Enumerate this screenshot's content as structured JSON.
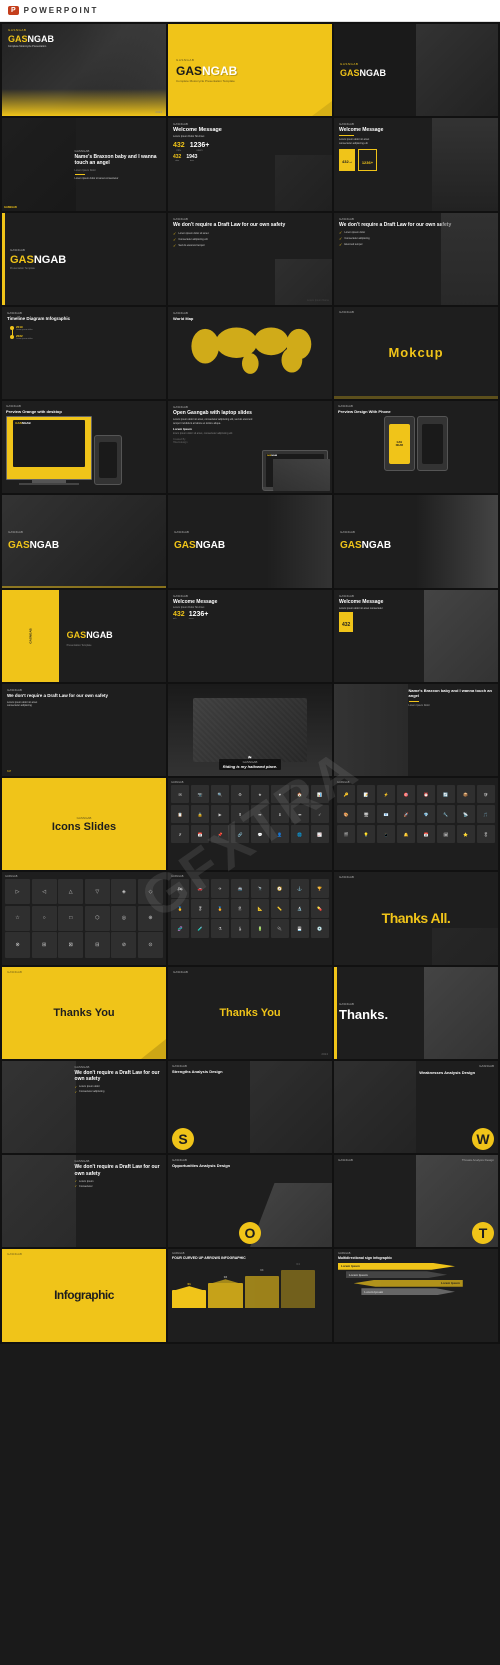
{
  "app": {
    "name": "POWERPOINT",
    "icon": "P",
    "watermark": "GFXTRA"
  },
  "slides": {
    "rows": [
      {
        "id": "row0",
        "slides": [
          {
            "id": "s0-0",
            "type": "top-bar",
            "label": "POWERPOINT",
            "content": "preview_header"
          }
        ]
      },
      {
        "id": "row1",
        "slides": [
          {
            "id": "s1-1",
            "type": "hero-dark",
            "title_yellow": "GAS",
            "title_white": "NGAB",
            "subtitle": ""
          },
          {
            "id": "s1-2",
            "type": "hero-yellow",
            "title_dark": "GAS",
            "title_dark2": "NGAB",
            "subtitle": "Complete Motorcycle Presentation Template"
          },
          {
            "id": "s1-3",
            "type": "hero-dark-bike",
            "title_yellow": "GAS",
            "title_white": "NGAB"
          }
        ]
      },
      {
        "id": "row2",
        "slides": [
          {
            "id": "s2-1",
            "type": "welcome-dark",
            "label": "GASNGAB",
            "name": "Name's Braxxon baby and I wanna touch an angel"
          },
          {
            "id": "s2-2",
            "type": "welcome-message",
            "label": "GASNGAB",
            "heading": "Welcome Message",
            "stats": [
              {
                "num": "432",
                "unit": "mil"
              },
              {
                "num": "1236+"
              }
            ]
          },
          {
            "id": "s2-3",
            "type": "welcome-message-2",
            "label": "GASNGAB",
            "heading": "Welcome Message"
          }
        ]
      },
      {
        "id": "row3",
        "slides": [
          {
            "id": "s3-1",
            "type": "yellow-left-dark",
            "label": "GASNGAB",
            "title_yellow": "GAS",
            "title_white": "NGAB"
          },
          {
            "id": "s3-2",
            "type": "safety-dark",
            "label": "GASNGAB",
            "heading": "We don't require a Draft Law for our own safety"
          },
          {
            "id": "s3-3",
            "type": "safety-dark-2",
            "label": "GASNGAB",
            "heading": "We don't require a Draft Law for our own safety"
          }
        ]
      },
      {
        "id": "row4",
        "slides": [
          {
            "id": "s4-1",
            "type": "timeline",
            "label": "GASNGAB",
            "heading": "Timeline Diagram Infographic"
          },
          {
            "id": "s4-2",
            "type": "world-map",
            "label": "GASNGAB",
            "heading": "World Map"
          },
          {
            "id": "s4-3",
            "type": "mockup-text",
            "label": "GASNGAB",
            "heading": "Mokcup"
          }
        ]
      },
      {
        "id": "row5",
        "slides": [
          {
            "id": "s5-1",
            "type": "desktop-preview",
            "label": "GASNGAB",
            "heading": "Preview Orange with desktop"
          },
          {
            "id": "s5-2",
            "type": "laptop-open",
            "label": "GASNGAB",
            "heading": "Open Gasngab with laptop slides",
            "sub": "Lorem Ipsum",
            "body": "Lorem ipsum dolor sit amet, consectetur adipiscing elit.",
            "created_by": "Created By HikeIndesign"
          },
          {
            "id": "s5-3",
            "type": "phone-preview",
            "label": "GASNGAB",
            "heading": "Preview Design With Phone"
          }
        ]
      },
      {
        "id": "row6",
        "slides": [
          {
            "id": "s6-1",
            "type": "hero-dark",
            "title_yellow": "GAS",
            "title_white": "NGAB"
          },
          {
            "id": "s6-2",
            "type": "hero-dark",
            "title_yellow": "GAS",
            "title_white": "NGAB"
          },
          {
            "id": "s6-3",
            "type": "hero-dark-bold",
            "title_yellow": "GAS",
            "title_white": "NGAB"
          }
        ]
      },
      {
        "id": "row7",
        "slides": [
          {
            "id": "s7-1",
            "type": "yellow-accent-left",
            "title_yellow": "GAS",
            "title_white": "NGAB"
          },
          {
            "id": "s7-2",
            "type": "welcome-stats",
            "heading": "Welcome Message",
            "stats": [
              {
                "num": "432",
                "unit": "mil"
              },
              {
                "num": "1236+"
              }
            ]
          },
          {
            "id": "s7-3",
            "type": "welcome-message-bike",
            "heading": "Welcome Message"
          }
        ]
      },
      {
        "id": "row8",
        "slides": [
          {
            "id": "s8-1",
            "type": "safety-check",
            "heading": "We don't require a Draft Law for our own safety"
          },
          {
            "id": "s8-2",
            "type": "riding-photo",
            "label": "GASNGAB",
            "caption": "Riding is my hallowed place."
          },
          {
            "id": "s8-3",
            "type": "person-quote",
            "heading": "Name's Braxxon baby and I wanna touch an angel"
          }
        ]
      },
      {
        "id": "row9",
        "slides": [
          {
            "id": "s9-1",
            "type": "icons-title",
            "heading": "Icons Slides"
          },
          {
            "id": "s9-2",
            "type": "icons-grid-1",
            "label": "GASNGAB"
          },
          {
            "id": "s9-3",
            "type": "icons-grid-2",
            "label": "GASNGAB"
          }
        ]
      },
      {
        "id": "row10",
        "slides": [
          {
            "id": "s10-1",
            "type": "icons-grid-3",
            "label": "GASNGAB"
          },
          {
            "id": "s10-2",
            "type": "icons-grid-4",
            "label": "GASNGAB"
          },
          {
            "id": "s10-3",
            "type": "thanks-all",
            "heading": "Thanks All."
          }
        ]
      },
      {
        "id": "row11",
        "slides": [
          {
            "id": "s11-1",
            "type": "thanks-yellow",
            "heading": "Thanks You"
          },
          {
            "id": "s11-2",
            "type": "thanks-yellow-2",
            "heading": "Thanks You"
          },
          {
            "id": "s11-3",
            "type": "thanks-dark",
            "heading": "Thanks."
          }
        ]
      },
      {
        "id": "row12",
        "slides": [
          {
            "id": "s12-1",
            "type": "safety-2",
            "heading": "We don't require a Draft Law for our own safety"
          },
          {
            "id": "s12-2",
            "type": "swot-s",
            "heading": "Strengths Analysis Design",
            "letter": "S"
          },
          {
            "id": "s12-3",
            "type": "swot-w",
            "heading": "Weaknesses Analysis Design",
            "letter": "W"
          }
        ]
      },
      {
        "id": "row13",
        "slides": [
          {
            "id": "s13-1",
            "type": "safety-3",
            "heading": "We don't require a Draft Law for our own safety"
          },
          {
            "id": "s13-2",
            "type": "swot-o",
            "heading": "Opportunities Analysis Design",
            "letter": "O"
          },
          {
            "id": "s13-3",
            "type": "swot-t",
            "heading": "Threats Analysis Design",
            "letter": "T"
          }
        ]
      },
      {
        "id": "row14",
        "slides": [
          {
            "id": "s14-1",
            "type": "infographic-title",
            "heading": "Infographic"
          },
          {
            "id": "s14-2",
            "type": "curved-arrows",
            "heading": "FOUR CURVED UP ARROWS INFOGRAPHIC"
          },
          {
            "id": "s14-3",
            "type": "multidirectional-signs",
            "heading": "Multidirectional sign infographic"
          }
        ]
      }
    ]
  },
  "icons": [
    "✉",
    "📷",
    "🔍",
    "⚙",
    "🔔",
    "📱",
    "💡",
    "🏠",
    "📊",
    "📋",
    "🔒",
    "▶",
    "⬆",
    "➡",
    "⬇",
    "⬅",
    "★",
    "♥",
    "✓",
    "✗",
    "📅",
    "🗓",
    "📌",
    "🔗",
    "💬",
    "👤",
    "🌐",
    "📈",
    "🔑",
    "📝",
    "⚡",
    "🎯",
    "⏰",
    "🔄",
    "📦",
    "🛡",
    "🎨",
    "🖥",
    "📧",
    "🚀",
    "💎",
    "🔧",
    "📡",
    "🎵",
    "🎬",
    "📷",
    "🔍",
    "⚙",
    "🔔",
    "📱",
    "💡",
    "🏠",
    "📊",
    "📋",
    "🔒",
    "▶",
    "⬆",
    "➡",
    "⬇",
    "⬅",
    "★",
    "♥",
    "✓",
    "✗",
    "📅",
    "🗓"
  ]
}
